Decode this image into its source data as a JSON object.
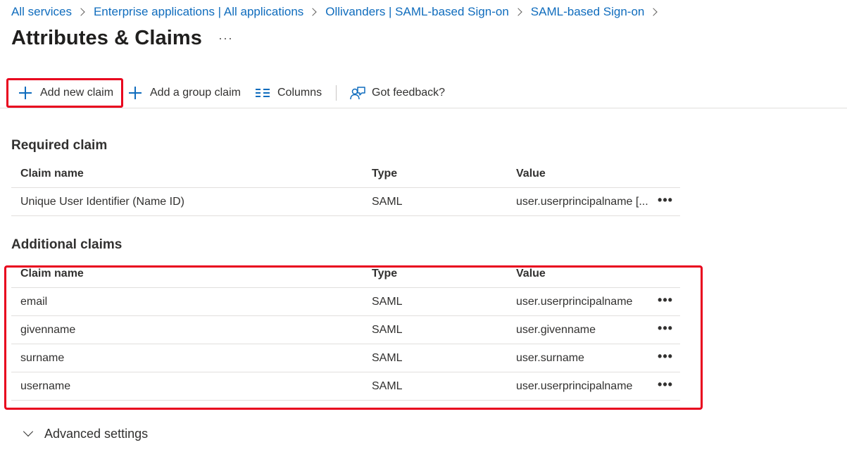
{
  "breadcrumb": [
    {
      "label": "All services"
    },
    {
      "label": "Enterprise applications | All applications"
    },
    {
      "label": "Ollivanders | SAML-based Sign-on"
    },
    {
      "label": "SAML-based Sign-on"
    }
  ],
  "page": {
    "title": "Attributes & Claims",
    "more_label": "···"
  },
  "toolbar": {
    "add_claim": {
      "label": "Add new claim",
      "icon": "plus-icon"
    },
    "add_group_claim": {
      "label": "Add a group claim",
      "icon": "plus-icon"
    },
    "columns": {
      "label": "Columns",
      "icon": "columns-icon"
    },
    "feedback": {
      "label": "Got feedback?",
      "icon": "feedback-icon"
    }
  },
  "required": {
    "title": "Required claim",
    "columns": {
      "name": "Claim name",
      "type": "Type",
      "value": "Value"
    },
    "rows": [
      {
        "name": "Unique User Identifier (Name ID)",
        "type": "SAML",
        "value": "user.userprincipalname [...",
        "more": "•••"
      }
    ]
  },
  "additional": {
    "title": "Additional claims",
    "columns": {
      "name": "Claim name",
      "type": "Type",
      "value": "Value"
    },
    "rows": [
      {
        "name": "email",
        "type": "SAML",
        "value": "user.userprincipalname",
        "more": "•••"
      },
      {
        "name": "givenname",
        "type": "SAML",
        "value": "user.givenname",
        "more": "•••"
      },
      {
        "name": "surname",
        "type": "SAML",
        "value": "user.surname",
        "more": "•••"
      },
      {
        "name": "username",
        "type": "SAML",
        "value": "user.userprincipalname",
        "more": "•••"
      }
    ]
  },
  "advanced": {
    "label": "Advanced settings"
  },
  "colors": {
    "accent": "#0f6cbd",
    "highlight": "#e8001d"
  }
}
